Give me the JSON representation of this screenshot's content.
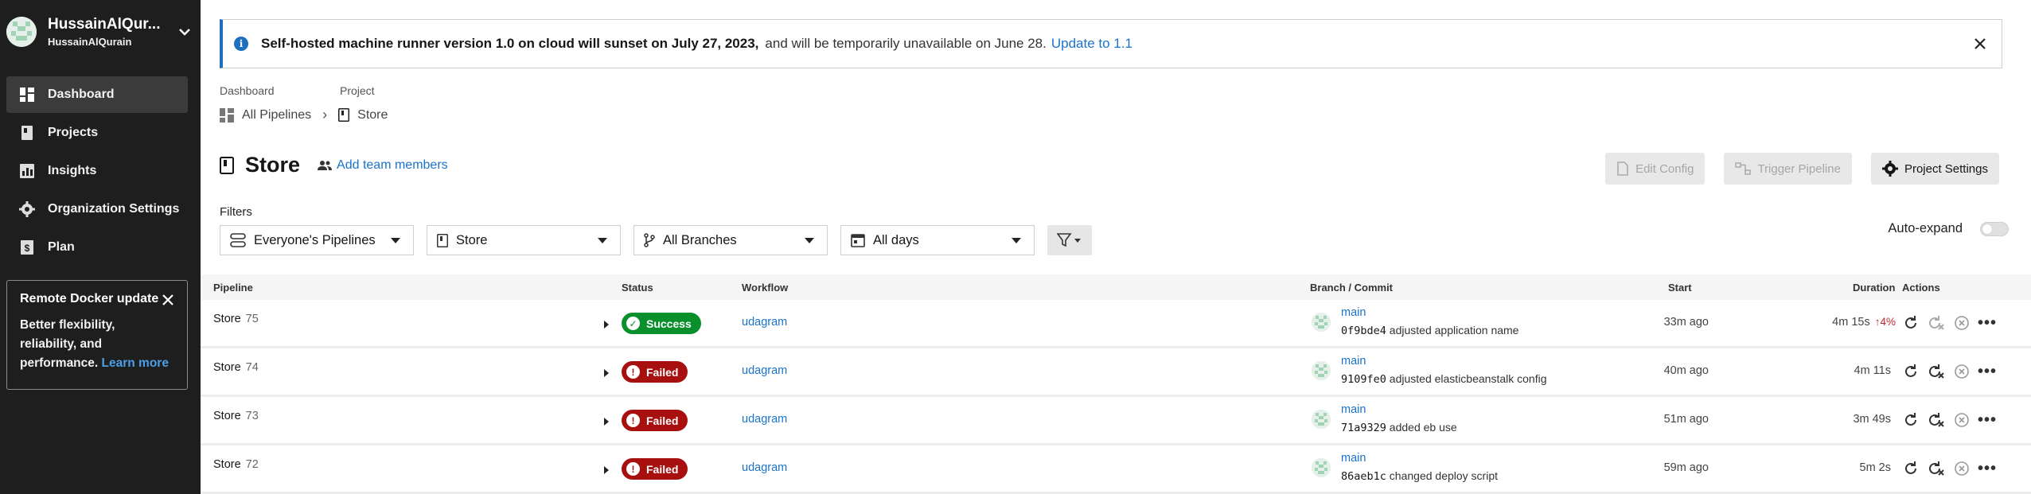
{
  "org": {
    "name": "HussainAlQur...",
    "handle": "HussainAlQurain"
  },
  "nav": [
    {
      "label": "Dashboard",
      "icon": "dashboard-icon",
      "active": true
    },
    {
      "label": "Projects",
      "icon": "projects-icon"
    },
    {
      "label": "Insights",
      "icon": "insights-icon"
    },
    {
      "label": "Organization Settings",
      "icon": "gear-icon"
    },
    {
      "label": "Plan",
      "icon": "plan-icon"
    }
  ],
  "promo": {
    "title": "Remote Docker update",
    "body": "Better flexibility, reliability, and performance.",
    "link": "Learn more"
  },
  "banner": {
    "bold": "Self-hosted machine runner version 1.0 on cloud will sunset on July 27, 2023,",
    "rest": "and will be temporarily unavailable on June 28.",
    "link": "Update to 1.1"
  },
  "breadcrumb": {
    "label1": "Dashboard",
    "label2": "Project",
    "item1": "All Pipelines",
    "item2": "Store"
  },
  "page": {
    "title": "Store",
    "add_team": "Add team members"
  },
  "actions": {
    "edit_config": "Edit Config",
    "trigger": "Trigger Pipeline",
    "settings": "Project Settings"
  },
  "filters": {
    "label": "Filters",
    "pipelines": "Everyone's Pipelines",
    "project": "Store",
    "branches": "All Branches",
    "days": "All days",
    "auto_expand": "Auto-expand"
  },
  "table": {
    "headers": {
      "pipeline": "Pipeline",
      "status": "Status",
      "workflow": "Workflow",
      "branch": "Branch / Commit",
      "start": "Start",
      "duration": "Duration",
      "actions": "Actions"
    },
    "rows": [
      {
        "name": "Store",
        "num": "75",
        "status": "Success",
        "workflow": "udagram",
        "branch": "main",
        "sha": "0f9bde4",
        "msg": "adjusted application name",
        "start": "33m ago",
        "duration": "4m 15s",
        "delta": "4%"
      },
      {
        "name": "Store",
        "num": "74",
        "status": "Failed",
        "workflow": "udagram",
        "branch": "main",
        "sha": "9109fe0",
        "msg": "adjusted elasticbeanstalk config",
        "start": "40m ago",
        "duration": "4m 11s",
        "delta": ""
      },
      {
        "name": "Store",
        "num": "73",
        "status": "Failed",
        "workflow": "udagram",
        "branch": "main",
        "sha": "71a9329",
        "msg": "added eb use",
        "start": "51m ago",
        "duration": "3m 49s",
        "delta": ""
      },
      {
        "name": "Store",
        "num": "72",
        "status": "Failed",
        "workflow": "udagram",
        "branch": "main",
        "sha": "86aeb1c",
        "msg": "changed deploy script",
        "start": "59m ago",
        "duration": "5m 2s",
        "delta": ""
      }
    ]
  },
  "colors": {
    "sidebar": "#1e1e1e",
    "accent": "#1a73c9",
    "success": "#0a8f2d",
    "failed": "#a80f0f"
  }
}
